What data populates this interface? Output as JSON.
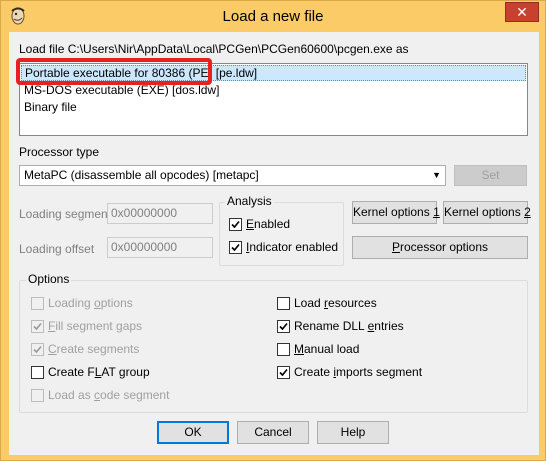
{
  "window": {
    "title": "Load a new file",
    "close_glyph": "✕",
    "app_icon": "ida-icon"
  },
  "load_file": {
    "label": "Load file C:\\Users\\Nir\\AppData\\Local\\PCGen\\PCGen60600\\pcgen.exe as",
    "items": [
      {
        "label": "Portable executable for 80386 (PE) [pe.ldw]",
        "selected": true
      },
      {
        "label": "MS-DOS executable (EXE) [dos.ldw]",
        "selected": false
      },
      {
        "label": "Binary file",
        "selected": false
      }
    ]
  },
  "processor": {
    "label": "Processor type",
    "selected": "MetaPC (disassemble all opcodes) [metapc]",
    "set_button": "Set"
  },
  "loading": {
    "segment_label": "Loading segment",
    "segment_value": "0x00000000",
    "offset_label": "Loading offset",
    "offset_value": "0x00000000"
  },
  "analysis": {
    "title": "Analysis",
    "enabled_label": "Enabled",
    "enabled_checked": true,
    "indicator_label": "Indicator enabled",
    "indicator_checked": true
  },
  "kernel": {
    "options1": "Kernel options 1",
    "options2": "Kernel options 2",
    "processor_options": "Processor options"
  },
  "options": {
    "title": "Options",
    "left": [
      {
        "label": "Loading options",
        "checked": false,
        "disabled": true
      },
      {
        "label": "Fill segment gaps",
        "checked": true,
        "disabled": true
      },
      {
        "label": "Create segments",
        "checked": true,
        "disabled": true
      },
      {
        "label": "Create FLAT group",
        "checked": false,
        "disabled": false
      },
      {
        "label": "Load as code segment",
        "checked": false,
        "disabled": true
      }
    ],
    "right": [
      {
        "label": "Load resources",
        "checked": false,
        "disabled": false
      },
      {
        "label": "Rename DLL entries",
        "checked": true,
        "disabled": false
      },
      {
        "label": "Manual load",
        "checked": false,
        "disabled": false
      },
      {
        "label": "Create imports segment",
        "checked": true,
        "disabled": false
      }
    ]
  },
  "buttons": {
    "ok": "OK",
    "cancel": "Cancel",
    "help": "Help"
  },
  "colors": {
    "title_bar": "#fbcb68",
    "close_button": "#c7412f",
    "highlight_ring": "#e8211e",
    "selection": "#cce8ff"
  }
}
